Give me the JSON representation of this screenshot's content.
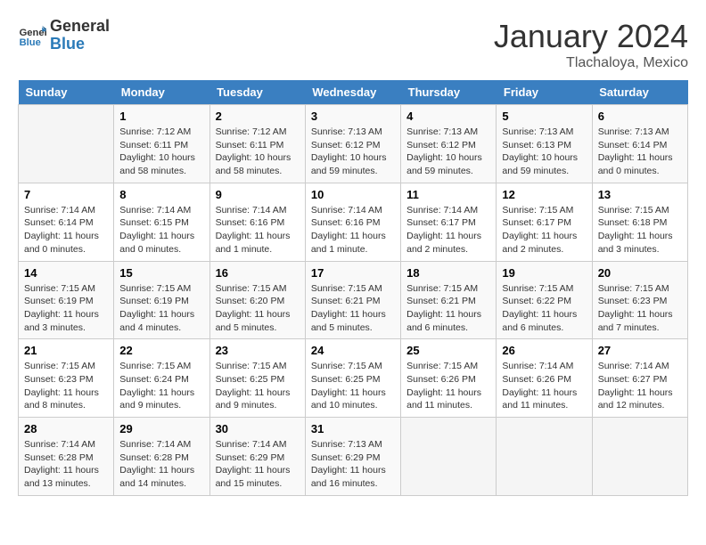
{
  "header": {
    "logo_line1": "General",
    "logo_line2": "Blue",
    "month": "January 2024",
    "location": "Tlachaloya, Mexico"
  },
  "days_of_week": [
    "Sunday",
    "Monday",
    "Tuesday",
    "Wednesday",
    "Thursday",
    "Friday",
    "Saturday"
  ],
  "weeks": [
    [
      {
        "day": "",
        "info": ""
      },
      {
        "day": "1",
        "info": "Sunrise: 7:12 AM\nSunset: 6:11 PM\nDaylight: 10 hours\nand 58 minutes."
      },
      {
        "day": "2",
        "info": "Sunrise: 7:12 AM\nSunset: 6:11 PM\nDaylight: 10 hours\nand 58 minutes."
      },
      {
        "day": "3",
        "info": "Sunrise: 7:13 AM\nSunset: 6:12 PM\nDaylight: 10 hours\nand 59 minutes."
      },
      {
        "day": "4",
        "info": "Sunrise: 7:13 AM\nSunset: 6:12 PM\nDaylight: 10 hours\nand 59 minutes."
      },
      {
        "day": "5",
        "info": "Sunrise: 7:13 AM\nSunset: 6:13 PM\nDaylight: 10 hours\nand 59 minutes."
      },
      {
        "day": "6",
        "info": "Sunrise: 7:13 AM\nSunset: 6:14 PM\nDaylight: 11 hours\nand 0 minutes."
      }
    ],
    [
      {
        "day": "7",
        "info": "Sunrise: 7:14 AM\nSunset: 6:14 PM\nDaylight: 11 hours\nand 0 minutes."
      },
      {
        "day": "8",
        "info": "Sunrise: 7:14 AM\nSunset: 6:15 PM\nDaylight: 11 hours\nand 0 minutes."
      },
      {
        "day": "9",
        "info": "Sunrise: 7:14 AM\nSunset: 6:16 PM\nDaylight: 11 hours\nand 1 minute."
      },
      {
        "day": "10",
        "info": "Sunrise: 7:14 AM\nSunset: 6:16 PM\nDaylight: 11 hours\nand 1 minute."
      },
      {
        "day": "11",
        "info": "Sunrise: 7:14 AM\nSunset: 6:17 PM\nDaylight: 11 hours\nand 2 minutes."
      },
      {
        "day": "12",
        "info": "Sunrise: 7:15 AM\nSunset: 6:17 PM\nDaylight: 11 hours\nand 2 minutes."
      },
      {
        "day": "13",
        "info": "Sunrise: 7:15 AM\nSunset: 6:18 PM\nDaylight: 11 hours\nand 3 minutes."
      }
    ],
    [
      {
        "day": "14",
        "info": "Sunrise: 7:15 AM\nSunset: 6:19 PM\nDaylight: 11 hours\nand 3 minutes."
      },
      {
        "day": "15",
        "info": "Sunrise: 7:15 AM\nSunset: 6:19 PM\nDaylight: 11 hours\nand 4 minutes."
      },
      {
        "day": "16",
        "info": "Sunrise: 7:15 AM\nSunset: 6:20 PM\nDaylight: 11 hours\nand 5 minutes."
      },
      {
        "day": "17",
        "info": "Sunrise: 7:15 AM\nSunset: 6:21 PM\nDaylight: 11 hours\nand 5 minutes."
      },
      {
        "day": "18",
        "info": "Sunrise: 7:15 AM\nSunset: 6:21 PM\nDaylight: 11 hours\nand 6 minutes."
      },
      {
        "day": "19",
        "info": "Sunrise: 7:15 AM\nSunset: 6:22 PM\nDaylight: 11 hours\nand 6 minutes."
      },
      {
        "day": "20",
        "info": "Sunrise: 7:15 AM\nSunset: 6:23 PM\nDaylight: 11 hours\nand 7 minutes."
      }
    ],
    [
      {
        "day": "21",
        "info": "Sunrise: 7:15 AM\nSunset: 6:23 PM\nDaylight: 11 hours\nand 8 minutes."
      },
      {
        "day": "22",
        "info": "Sunrise: 7:15 AM\nSunset: 6:24 PM\nDaylight: 11 hours\nand 9 minutes."
      },
      {
        "day": "23",
        "info": "Sunrise: 7:15 AM\nSunset: 6:25 PM\nDaylight: 11 hours\nand 9 minutes."
      },
      {
        "day": "24",
        "info": "Sunrise: 7:15 AM\nSunset: 6:25 PM\nDaylight: 11 hours\nand 10 minutes."
      },
      {
        "day": "25",
        "info": "Sunrise: 7:15 AM\nSunset: 6:26 PM\nDaylight: 11 hours\nand 11 minutes."
      },
      {
        "day": "26",
        "info": "Sunrise: 7:14 AM\nSunset: 6:26 PM\nDaylight: 11 hours\nand 11 minutes."
      },
      {
        "day": "27",
        "info": "Sunrise: 7:14 AM\nSunset: 6:27 PM\nDaylight: 11 hours\nand 12 minutes."
      }
    ],
    [
      {
        "day": "28",
        "info": "Sunrise: 7:14 AM\nSunset: 6:28 PM\nDaylight: 11 hours\nand 13 minutes."
      },
      {
        "day": "29",
        "info": "Sunrise: 7:14 AM\nSunset: 6:28 PM\nDaylight: 11 hours\nand 14 minutes."
      },
      {
        "day": "30",
        "info": "Sunrise: 7:14 AM\nSunset: 6:29 PM\nDaylight: 11 hours\nand 15 minutes."
      },
      {
        "day": "31",
        "info": "Sunrise: 7:13 AM\nSunset: 6:29 PM\nDaylight: 11 hours\nand 16 minutes."
      },
      {
        "day": "",
        "info": ""
      },
      {
        "day": "",
        "info": ""
      },
      {
        "day": "",
        "info": ""
      }
    ]
  ]
}
